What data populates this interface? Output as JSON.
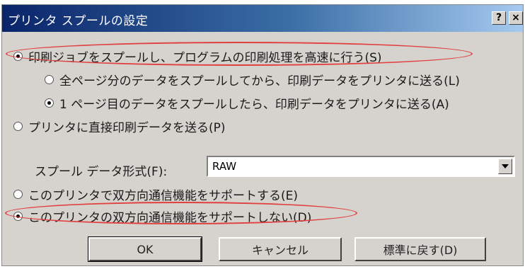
{
  "window": {
    "title": "プリンタ スプールの設定",
    "help_label": "?",
    "close_label": "×"
  },
  "options": {
    "spool": "印刷ジョブをスプールし、プログラムの印刷処理を高速に行う(S)",
    "after_all_pages": "全ページ分のデータをスプールしてから、印刷データをプリンタに送る(L)",
    "after_first_page": "1 ページ目のデータをスプールしたら、印刷データをプリンタに送る(A)",
    "direct": "プリンタに直接印刷データを送る(P)"
  },
  "spool_format": {
    "label": "スプール データ形式(F):",
    "value": "RAW"
  },
  "bidi": {
    "enable": "このプリンタで双方向通信機能をサポートする(E)",
    "disable": "このプリンタの双方向通信機能をサポートしない(D)"
  },
  "buttons": {
    "ok": "OK",
    "cancel": "キャンセル",
    "restore_defaults": "標準に戻す(D)"
  },
  "highlight_color": "#e04040"
}
